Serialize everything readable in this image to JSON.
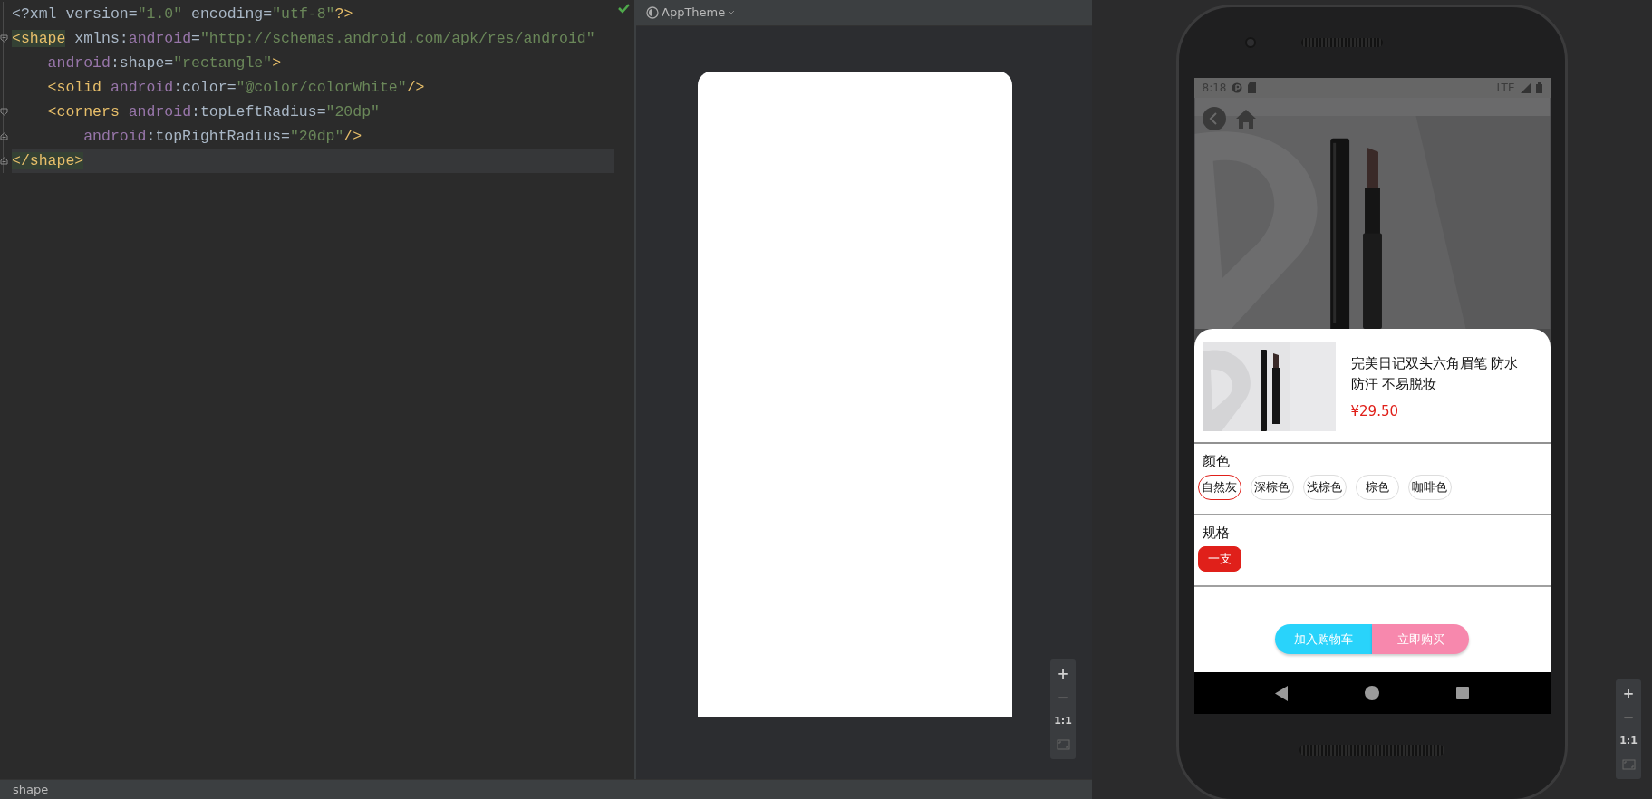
{
  "editor": {
    "inspection_passed": true,
    "lines": [
      {
        "fold_start": false,
        "fold_end": false,
        "current": false,
        "tokens": [
          {
            "kind": "text",
            "text": "<?xml version="
          },
          {
            "kind": "value",
            "text": "\"1.0\""
          },
          {
            "kind": "text",
            "text": " encoding="
          },
          {
            "kind": "value",
            "text": "\"utf-8\""
          },
          {
            "kind": "tag",
            "text": "?>"
          }
        ]
      },
      {
        "fold_start": true,
        "fold_end": false,
        "current": false,
        "tokens": [
          {
            "kind": "tag",
            "text": "<shape",
            "matched": true
          },
          {
            "kind": "text",
            "text": " xmlns:"
          },
          {
            "kind": "ns",
            "text": "android"
          },
          {
            "kind": "text",
            "text": "="
          },
          {
            "kind": "value",
            "text": "\"http://schemas.android.com/apk/res/android\""
          }
        ],
        "children": [
          {
            "fold_start": false,
            "fold_end": false,
            "current": false,
            "tokens": [
              {
                "kind": "ns",
                "text": "android"
              },
              {
                "kind": "text",
                "text": ":shape="
              },
              {
                "kind": "value",
                "text": "\"rectangle\""
              },
              {
                "kind": "tag",
                "text": ">"
              }
            ]
          },
          {
            "fold_start": false,
            "fold_end": false,
            "current": false,
            "tokens": [
              {
                "kind": "tag",
                "text": "<solid "
              },
              {
                "kind": "ns",
                "text": "android"
              },
              {
                "kind": "text",
                "text": ":color="
              },
              {
                "kind": "value",
                "text": "\"@color/colorWhite\""
              },
              {
                "kind": "tag",
                "text": "/>"
              }
            ]
          },
          {
            "fold_start": true,
            "fold_end": false,
            "current": false,
            "tokens": [
              {
                "kind": "tag",
                "text": "<corners "
              },
              {
                "kind": "ns",
                "text": "android"
              },
              {
                "kind": "text",
                "text": ":topLeftRadius="
              },
              {
                "kind": "value",
                "text": "\"20dp\""
              }
            ],
            "children": [
              {
                "fold_start": false,
                "fold_end": true,
                "current": false,
                "tokens": [
                  {
                    "kind": "ns",
                    "text": "android"
                  },
                  {
                    "kind": "text",
                    "text": ":topRightRadius="
                  },
                  {
                    "kind": "value",
                    "text": "\"20dp\""
                  },
                  {
                    "kind": "tag",
                    "text": "/>"
                  }
                ]
              }
            ]
          }
        ]
      },
      {
        "fold_start": false,
        "fold_end": true,
        "current": true,
        "tokens": [
          {
            "kind": "tag",
            "text": "</shape>",
            "matched": true
          }
        ]
      }
    ]
  },
  "preview": {
    "theme": "AppTheme",
    "zoom_controls": [
      {
        "kind": "text",
        "label": "+",
        "disabled": false
      },
      {
        "kind": "text",
        "label": "−",
        "disabled": true
      },
      {
        "kind": "text",
        "label": "1:1",
        "disabled": false
      },
      {
        "kind": "fit",
        "disabled": true
      }
    ]
  },
  "status_bar": {
    "text": "shape"
  },
  "device": {
    "phone_status": {
      "time": "8:18",
      "network": "LTE"
    },
    "product": {
      "title": "完美日记双头六角眉笔 防水防汗 不易脱妆",
      "price": "¥29.50"
    },
    "option_groups": [
      {
        "label": "颜色",
        "kind": "outline",
        "options": [
          {
            "label": "自然灰",
            "selected": true
          },
          {
            "label": "深棕色",
            "selected": false
          },
          {
            "label": "浅棕色",
            "selected": false
          },
          {
            "label": "棕色",
            "selected": false
          },
          {
            "label": "咖啡色",
            "selected": false
          }
        ]
      },
      {
        "label": "规格",
        "kind": "filled",
        "options": [
          {
            "label": "一支",
            "selected": true
          }
        ]
      }
    ],
    "actions": [
      {
        "kind": "cart",
        "label": "加入购物车"
      },
      {
        "kind": "buy",
        "label": "立即购买"
      }
    ],
    "zoom_controls": [
      {
        "kind": "text",
        "label": "+",
        "disabled": false
      },
      {
        "kind": "text",
        "label": "−",
        "disabled": true
      },
      {
        "kind": "text",
        "label": "1:1",
        "disabled": false
      },
      {
        "kind": "fit",
        "disabled": true
      }
    ]
  }
}
